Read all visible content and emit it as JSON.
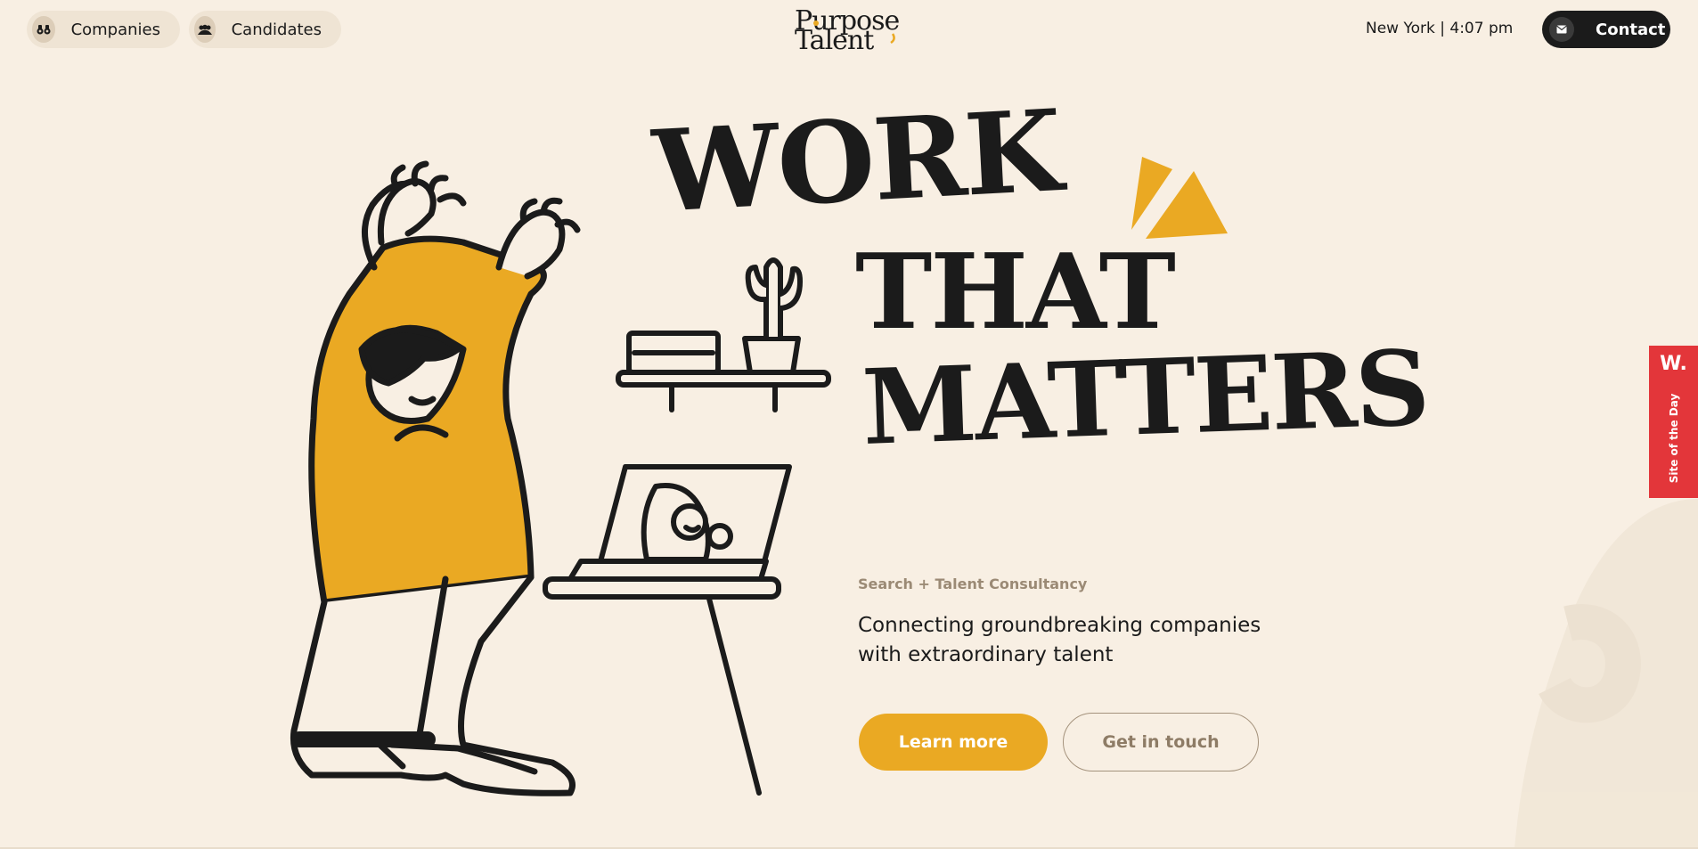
{
  "nav": {
    "companies_label": "Companies",
    "candidates_label": "Candidates"
  },
  "logo": {
    "line1": "Purpose",
    "line2": "Talent"
  },
  "clock": {
    "text": "New York | 4:07 pm"
  },
  "contact": {
    "label": "Contact"
  },
  "hero": {
    "line1": "WORK",
    "line2": "THAT",
    "line3": "MATTERS",
    "eyebrow": "Search + Talent Consultancy",
    "description": "Connecting groundbreaking companies with extraordinary talent",
    "primary_button": "Learn more",
    "secondary_button": "Get in touch"
  },
  "badge": {
    "mark": "W.",
    "label": "Site of the Day"
  },
  "colors": {
    "background": "#f8efe3",
    "accent": "#eaa923",
    "ink": "#1b1b1b",
    "badge": "#e3363a",
    "muted": "#9b8a75"
  },
  "icons": {
    "companies": "binoculars-icon",
    "candidates": "people-icon",
    "contact": "mail-icon"
  }
}
